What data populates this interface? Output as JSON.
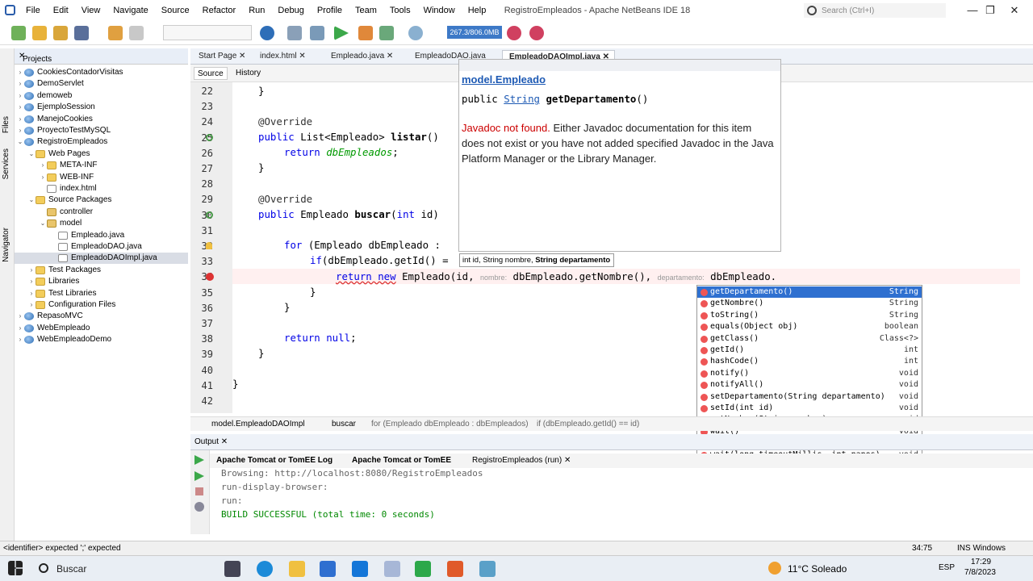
{
  "window": {
    "title": "RegistroEmpleados - Apache NetBeans IDE 18",
    "search_placeholder": "Search (Ctrl+I)",
    "min": "—",
    "max": "❐",
    "close": "✕"
  },
  "menu": [
    "File",
    "Edit",
    "View",
    "Navigate",
    "Source",
    "Refactor",
    "Run",
    "Debug",
    "Profile",
    "Team",
    "Tools",
    "Window",
    "Help"
  ],
  "toolbar": {
    "memory": "267.3/806.0MB"
  },
  "side_tabs": [
    "Files",
    "Services",
    "Navigator"
  ],
  "projects": {
    "title": "Projects",
    "items": [
      {
        "label": "CookiesContadorVisitas",
        "icon": "globe"
      },
      {
        "label": "DemoServlet",
        "icon": "globe"
      },
      {
        "label": "demoweb",
        "icon": "globe"
      },
      {
        "label": "EjemploSession",
        "icon": "globe"
      },
      {
        "label": "ManejoCookies",
        "icon": "globe"
      },
      {
        "label": "ProyectoTestMySQL",
        "icon": "globe"
      },
      {
        "label": "RegistroEmpleados",
        "icon": "globe"
      },
      {
        "label": "Web Pages",
        "icon": "folder"
      },
      {
        "label": "META-INF",
        "icon": "folder"
      },
      {
        "label": "WEB-INF",
        "icon": "folder"
      },
      {
        "label": "index.html",
        "icon": "file"
      },
      {
        "label": "Source Packages",
        "icon": "folder"
      },
      {
        "label": "controller",
        "icon": "pkg"
      },
      {
        "label": "model",
        "icon": "pkg"
      },
      {
        "label": "Empleado.java",
        "icon": "file"
      },
      {
        "label": "EmpleadoDAO.java",
        "icon": "file"
      },
      {
        "label": "EmpleadoDAOImpl.java",
        "icon": "file"
      },
      {
        "label": "Test Packages",
        "icon": "folder"
      },
      {
        "label": "Libraries",
        "icon": "folder"
      },
      {
        "label": "Test Libraries",
        "icon": "folder"
      },
      {
        "label": "Configuration Files",
        "icon": "folder"
      },
      {
        "label": "RepasoMVC",
        "icon": "globe"
      },
      {
        "label": "WebEmpleado",
        "icon": "globe"
      },
      {
        "label": "WebEmpleadoDemo",
        "icon": "globe"
      }
    ]
  },
  "editor_tabs": [
    "Start Page",
    "index.html",
    "Empleado.java",
    "EmpleadoDAO.java",
    "EmpleadoDAOImpl.java"
  ],
  "source_tabs": [
    "Source",
    "History"
  ],
  "lines": [
    "22",
    "23",
    "24",
    "25",
    "26",
    "27",
    "28",
    "29",
    "30",
    "31",
    "32",
    "33",
    "34",
    "35",
    "36",
    "37",
    "38",
    "39",
    "40",
    "41",
    "42"
  ],
  "code": {
    "l22": "}",
    "l24": "@Override",
    "l25a": "public",
    "l25b": " List<Empleado> ",
    "l25c": "listar",
    "l25d": "()",
    "l26a": "return ",
    "l26b": "dbEmpleados",
    "l26c": ";",
    "l27": "}",
    "l29": "@Override",
    "l30a": "public",
    "l30b": " Empleado ",
    "l30c": "buscar",
    "l30d": "(",
    "l30e": "int",
    "l30f": " id)",
    "l32a": "for",
    "l32b": " (Empleado dbEmpleado :",
    "l33a": "if",
    "l33b": "(dbEmpleado.getId() =",
    "l34a": "return new",
    "l34b": " Empleado(id, ",
    "l34c": "nombre:",
    "l34d": " dbEmpleado.getNombre(), ",
    "l34e": "departamento:",
    "l34f": " dbEmpleado.",
    "l35": "}",
    "l36": "}",
    "l38a": "return null",
    "l38b": ";",
    "l39": "}",
    "l41": "}"
  },
  "javadoc": {
    "class": "model.Empleado",
    "sig_public": "public",
    "sig_type": "String",
    "sig_method": "getDepartamento",
    "sig_parens": "()",
    "msg_red": "Javadoc not found.",
    "msg": " Either Javadoc documentation for this item does not exist or you have not added specified Javadoc in the Java Platform Manager or the Library Manager."
  },
  "param_tip": {
    "pre": "int id, String nombre, ",
    "bold": "String departamento"
  },
  "completion": [
    {
      "name": "getDepartamento()",
      "type": "String"
    },
    {
      "name": "getNombre()",
      "type": "String"
    },
    {
      "name": "toString()",
      "type": "String"
    },
    {
      "name": "equals(Object obj)",
      "type": "boolean"
    },
    {
      "name": "getClass()",
      "type": "Class<?>"
    },
    {
      "name": "getId()",
      "type": "int"
    },
    {
      "name": "hashCode()",
      "type": "int"
    },
    {
      "name": "notify()",
      "type": "void"
    },
    {
      "name": "notifyAll()",
      "type": "void"
    },
    {
      "name": "setDepartamento(String departamento)",
      "type": "void"
    },
    {
      "name": "setId(int id)",
      "type": "void"
    },
    {
      "name": "setNombre(String nombre)",
      "type": "void"
    },
    {
      "name": "wait()",
      "type": "void"
    },
    {
      "name": "wait(long timeoutMillis)",
      "type": "void"
    },
    {
      "name": "wait(long timeoutMillis, int nanos)",
      "type": "void"
    }
  ],
  "breadcrumb": [
    "model.EmpleadoDAOImpl",
    "buscar",
    "for (Empleado dbEmpleado : dbEmpleados)",
    "if (dbEmpleado.getId() == id)"
  ],
  "output": {
    "title": "Output",
    "tabs": [
      "Apache Tomcat or TomEE Log",
      "Apache Tomcat or TomEE",
      "RegistroEmpleados (run)"
    ],
    "lines": [
      "Browsing: http://localhost:8080/RegistroEmpleados",
      "run-display-browser:",
      "run:"
    ],
    "success": "BUILD SUCCESSFUL (total time: 0 seconds)"
  },
  "status": {
    "message": "<identifier> expected  ';' expected",
    "position": "34:75",
    "mode": "INS Windows (CRLF)"
  },
  "taskbar": {
    "search": "Buscar",
    "weather": "11°C Soleado",
    "lang": "ESP",
    "time": "17:29",
    "date": "7/8/2023"
  }
}
